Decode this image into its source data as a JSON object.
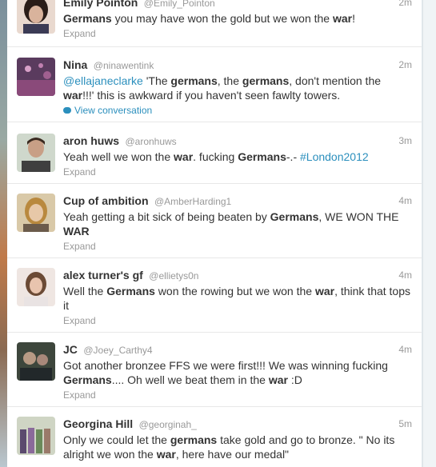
{
  "tweets": [
    {
      "fullname": "Emily Pointon",
      "username": "@Emily_Pointon",
      "time": "2m",
      "segments": [
        {
          "t": "Germans",
          "b": true
        },
        {
          "t": " you may have won the gold but we won the "
        },
        {
          "t": "war",
          "b": true
        },
        {
          "t": "!"
        }
      ],
      "footer": "Expand"
    },
    {
      "fullname": "Nina",
      "username": "@ninawentink",
      "time": "2m",
      "segments": [
        {
          "t": "@ellajaneclarke",
          "link": true
        },
        {
          "t": " 'The "
        },
        {
          "t": "germans",
          "b": true
        },
        {
          "t": ", the "
        },
        {
          "t": "germans",
          "b": true
        },
        {
          "t": ", don't mention the "
        },
        {
          "t": "war",
          "b": true
        },
        {
          "t": "!!!' this is awkward if you haven't seen fawlty towers."
        }
      ],
      "footer": "View conversation",
      "footer_link": true
    },
    {
      "fullname": "aron huws",
      "username": "@aronhuws",
      "time": "3m",
      "segments": [
        {
          "t": "Yeah well we won the "
        },
        {
          "t": "war",
          "b": true
        },
        {
          "t": ". fucking "
        },
        {
          "t": "Germans",
          "b": true
        },
        {
          "t": "-.- "
        },
        {
          "t": "#London2012",
          "link": true
        }
      ],
      "footer": "Expand"
    },
    {
      "fullname": "Cup of ambition",
      "username": "@AmberHarding1",
      "time": "4m",
      "segments": [
        {
          "t": "Yeah getting a bit sick of being beaten by "
        },
        {
          "t": "Germans",
          "b": true
        },
        {
          "t": ", WE WON THE "
        },
        {
          "t": "WAR",
          "b": true
        }
      ],
      "footer": "Expand"
    },
    {
      "fullname": "alex turner's gf",
      "username": "@ellietys0n",
      "time": "4m",
      "segments": [
        {
          "t": "Well the "
        },
        {
          "t": "Germans",
          "b": true
        },
        {
          "t": " won the rowing but we won the "
        },
        {
          "t": "war",
          "b": true
        },
        {
          "t": ", think that tops it"
        }
      ],
      "footer": "Expand"
    },
    {
      "fullname": "JC",
      "username": "@Joey_Carthy4",
      "time": "4m",
      "segments": [
        {
          "t": "Got another bronzee FFS we were first!!! We was winning fucking "
        },
        {
          "t": "Germans",
          "b": true
        },
        {
          "t": ".... Oh well we beat them in the "
        },
        {
          "t": "war",
          "b": true
        },
        {
          "t": " :D"
        }
      ],
      "footer": "Expand"
    },
    {
      "fullname": "Georgina Hill",
      "username": "@georginah_",
      "time": "5m",
      "segments": [
        {
          "t": "Only we could let the "
        },
        {
          "t": "germans",
          "b": true
        },
        {
          "t": " take gold and go to bronze. \" No its alright we won the "
        },
        {
          "t": "war",
          "b": true
        },
        {
          "t": ", here have our medal\""
        }
      ],
      "footer": ""
    }
  ],
  "colors": {
    "link": "#2b8fbd",
    "muted": "#999999",
    "text": "#333333"
  },
  "icons": {
    "view_conversation": "speech-bubble-icon"
  }
}
